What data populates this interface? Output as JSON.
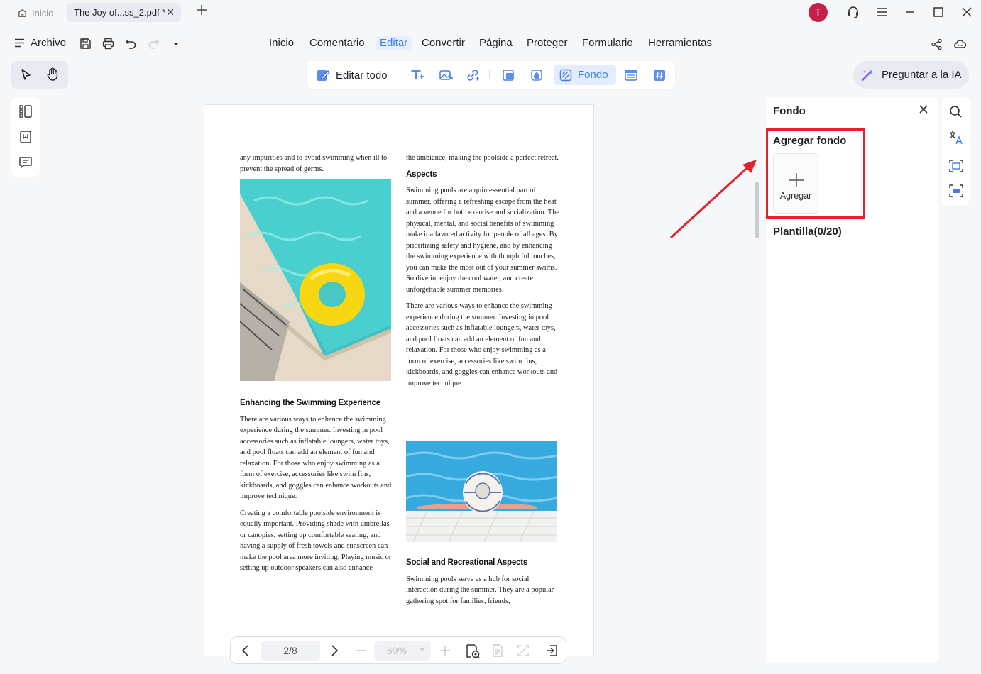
{
  "titlebar": {
    "home_tab": "Inicio",
    "doc_tab": "The Joy of...ss_2.pdf *",
    "avatar_initial": "T"
  },
  "menubar": {
    "archivo": "Archivo",
    "items": [
      "Inicio",
      "Comentario",
      "Editar",
      "Convertir",
      "Página",
      "Proteger",
      "Formulario",
      "Herramientas"
    ],
    "active": "Editar"
  },
  "edit_toolbar": {
    "edit_all": "Editar todo",
    "background": "Fondo"
  },
  "ai_button": "Preguntar a la IA",
  "document": {
    "left_column": {
      "intro": "any impurities and to avoid swimming when ill to prevent the spread of germs.",
      "heading1": "Enhancing the Swimming Experience",
      "para1": "There are various ways to enhance the swimming experience during the summer. Investing in pool accessories such as inflatable loungers, water toys, and pool floats can add an element of fun and relaxation. For those who enjoy swimming as a form of exercise, accessories like swim fins, kickboards, and goggles can enhance workouts and improve technique.",
      "para2": "Creating a comfortable poolside environment is equally important. Providing shade with umbrellas or canopies, setting up comfortable seating, and having a supply of fresh towels and sunscreen can make the pool area more inviting. Playing music or setting up outdoor speakers can also enhance"
    },
    "right_column": {
      "intro": "the ambiance, making the poolside a perfect retreat.",
      "heading1": "Aspects",
      "para1": "Swimming pools are a quintessential part of summer, offering a refreshing escape from the heat and a venue for both exercise and socialization. The physical, mental, and social benefits of swimming make it a favored activity for people of all ages. By prioritizing safety and hygiene, and by enhancing the swimming experience with thoughtful touches, you can make the most out of your summer swims. So dive in, enjoy the cool water, and create unforgettable summer memories.",
      "para2": "There are various ways to enhance the swimming experience during the summer. Investing in pool accessories such as inflatable loungers, water toys, and pool floats can add an element of fun and relaxation. For those who enjoy swimming as a form of exercise, accessories like swim fins, kickboards, and goggles can enhance workouts and improve technique.",
      "heading2": "Social and Recreational Aspects",
      "para3": "Swimming pools serve as a hub for social interaction during the summer. They are a popular gathering spot for families, friends,"
    }
  },
  "panel": {
    "title": "Fondo",
    "add_section": "Agregar fondo",
    "add_label": "Agregar",
    "template_section": "Plantilla(0/20)"
  },
  "bottom_nav": {
    "page": "2/8",
    "zoom": "69%"
  },
  "colors": {
    "accent": "#3f7fe6",
    "highlight_red": "#e0222c",
    "avatar": "#c61f4a"
  }
}
